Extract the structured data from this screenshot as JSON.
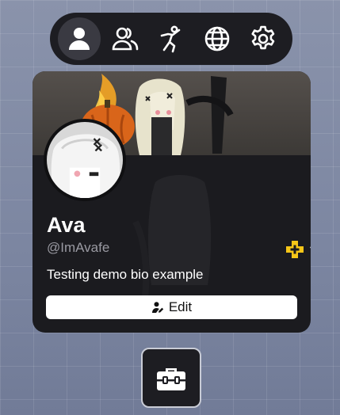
{
  "nav": {
    "items": [
      {
        "icon": "person-icon",
        "active": true
      },
      {
        "icon": "friends-icon",
        "active": false
      },
      {
        "icon": "emote-icon",
        "active": false
      },
      {
        "icon": "globe-icon",
        "active": false
      },
      {
        "icon": "gear-icon",
        "active": false
      }
    ]
  },
  "profile": {
    "display_name": "Ava",
    "username": "@ImAvafe",
    "bio": "Testing demo bio example",
    "edit_label": "Edit",
    "badges": [
      {
        "icon": "premium-plus-icon",
        "color": "#f5c518"
      },
      {
        "icon": "star-badge-icon",
        "color": "#ffffff"
      }
    ]
  },
  "toolbox": {
    "icon": "toolbox-icon"
  },
  "colors": {
    "panel": "#1d1d22",
    "card": "#1b1b1f",
    "accent_gold": "#f5c518",
    "muted_text": "#9a9aa2",
    "button_bg": "#ffffff"
  }
}
